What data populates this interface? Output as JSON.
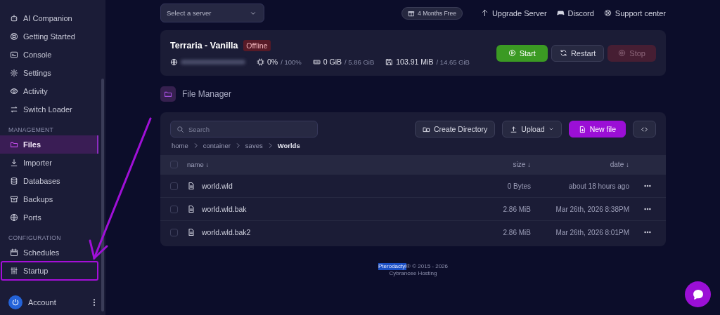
{
  "sidebar": {
    "groups": [
      {
        "items": [
          {
            "label": "AI Companion",
            "selected": false,
            "highlighted": false
          },
          {
            "label": "Getting Started",
            "selected": false,
            "highlighted": false
          },
          {
            "label": "Console",
            "selected": false,
            "highlighted": false
          },
          {
            "label": "Settings",
            "selected": false,
            "highlighted": false
          },
          {
            "label": "Activity",
            "selected": false,
            "highlighted": false
          },
          {
            "label": "Switch Loader",
            "selected": false,
            "highlighted": false
          }
        ]
      },
      {
        "heading": "MANAGEMENT",
        "items": [
          {
            "label": "Files",
            "selected": true,
            "highlighted": false
          },
          {
            "label": "Importer",
            "selected": false,
            "highlighted": false
          },
          {
            "label": "Databases",
            "selected": false,
            "highlighted": false
          },
          {
            "label": "Backups",
            "selected": false,
            "highlighted": false
          },
          {
            "label": "Ports",
            "selected": false,
            "highlighted": false
          }
        ]
      },
      {
        "heading": "CONFIGURATION",
        "items": [
          {
            "label": "Schedules",
            "selected": false,
            "highlighted": false
          },
          {
            "label": "Startup",
            "selected": false,
            "highlighted": true
          }
        ]
      }
    ],
    "account": {
      "label": "Account"
    }
  },
  "topbar": {
    "server_select": {
      "placeholder": "Select a server"
    },
    "promo": "4 Months Free",
    "links": [
      "Upgrade Server",
      "Discord",
      "Support center"
    ]
  },
  "server": {
    "name": "Terraria - Vanilla",
    "status": "Offline",
    "cpu": "0%",
    "cpu_limit": "/ 100%",
    "memory": "0 GiB",
    "memory_limit": "/ 5.86 GiB",
    "disk": "103.91 MiB",
    "disk_limit": "/ 14.65 GiB",
    "buttons": [
      {
        "label": "Start",
        "kind": "start",
        "disabled": false
      },
      {
        "label": "Restart",
        "kind": "restart",
        "disabled": false
      },
      {
        "label": "Stop",
        "kind": "stop",
        "disabled": true
      }
    ]
  },
  "file_manager": {
    "title": "File Manager",
    "search": {
      "placeholder": "Search"
    },
    "actions": [
      {
        "label": "Create Directory",
        "kind": "create"
      },
      {
        "label": "Upload",
        "kind": "upload"
      },
      {
        "label": "New file",
        "kind": "new"
      },
      {
        "kind": "code"
      }
    ],
    "breadcrumb": [
      {
        "label": "home",
        "current": false
      },
      {
        "label": "container",
        "current": false
      },
      {
        "label": "saves",
        "current": false
      },
      {
        "label": "Worlds",
        "current": true
      }
    ],
    "all_checked": false,
    "columns": [
      "name ↓",
      "size ↓",
      "date ↓"
    ],
    "rows": [
      {
        "name": "world.wld",
        "size": "0 Bytes",
        "date": "about 18 hours ago",
        "checked": false
      },
      {
        "name": "world.wld.bak",
        "size": "2.86 MiB",
        "date": "Mar 26th, 2026 8:38PM",
        "checked": false
      },
      {
        "name": "world.wld.bak2",
        "size": "2.86 MiB",
        "date": "Mar 26th, 2026 8:01PM",
        "checked": false
      }
    ]
  },
  "footer": {
    "brand": "Pterodactyl",
    "brand_selected": true,
    "copyright": "® © 2015 - 2026",
    "company": "Cybrancee Hosting"
  },
  "annotation": {
    "arrow": true
  }
}
